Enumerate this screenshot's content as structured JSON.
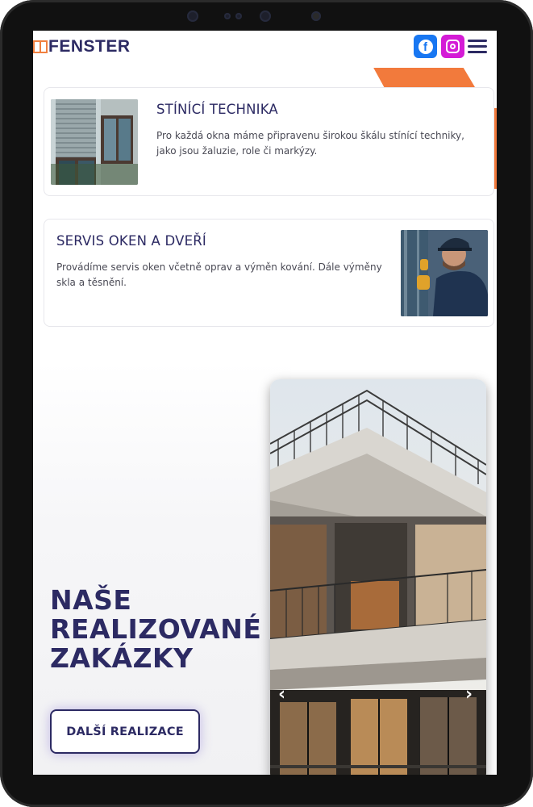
{
  "header": {
    "logo_text": "FENSTER",
    "facebook_icon": "facebook-icon",
    "instagram_icon": "instagram-icon",
    "menu_icon": "hamburger-menu-icon"
  },
  "colors": {
    "brand": "#2c2a63",
    "accent": "#f27a3c",
    "facebook": "#1877f2",
    "instagram": "#d41bd6"
  },
  "services": [
    {
      "title": "STÍNÍCÍ TECHNIKA",
      "text": "Pro každá okna máme připravenu širokou škálu stínící techniky, jako jsou žaluzie, role či markýzy."
    },
    {
      "title": "SERVIS OKEN A DVEŘÍ",
      "text": "Provádíme servis oken včetně oprav a výměn kování. Dále výměny skla a těsnění."
    }
  ],
  "realizace": {
    "title_lines": [
      "NAŠE",
      "REALIZOVANÉ",
      "ZAKÁZKY"
    ],
    "button_label": "DALŠÍ REALIZACE",
    "prev_arrow": "‹",
    "next_arrow": "›"
  }
}
